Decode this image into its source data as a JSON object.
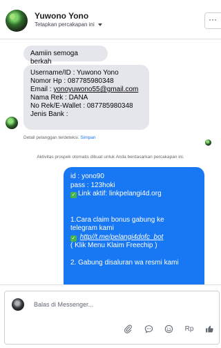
{
  "header": {
    "name": "Yuwono Yono",
    "subtitle": "Tetapkan percakapan ini",
    "more_label": "···"
  },
  "messages": {
    "m1": "Aamiin semoga berkah",
    "m2_lines": [
      "Username/ID : Yuwono Yono",
      "Nomor Hp : 087785980348",
      "Email : ",
      "Nama Rek : DANA",
      "No Rek/E-Wallet : 087785980348",
      "Jenis Bank :"
    ],
    "email_link": "yonoyuwono55@gmail.com",
    "detect_text": "Detail pelanggan terdeteksi.",
    "detect_save": "Simpan",
    "notice": "Aktivitas prospek otomatis dibuat untuk Anda berdasarkan percakapan ini.",
    "blue": {
      "l1": "id : yono90",
      "l2": "pass : 123hoki",
      "l3": "Link aktif: linkpelangi4d.org",
      "l4": "1.Cara claim bonus gabung ke",
      "l5": "telegram kami",
      "link2": "http//t.me/pelangi4dofc_bot",
      "l6": "( Klik Menu Klaim Freechip )",
      "l7": "2. Gabung disaluran wa resmi kami"
    }
  },
  "composer": {
    "placeholder": "Balas di Messenger...",
    "rp_label": "Rp"
  },
  "icons": {
    "checkmark": "green-check-icon",
    "clip": "paperclip-icon",
    "chat": "chat-bubble-icon",
    "smile": "smiley-icon",
    "like": "thumbs-up-icon"
  }
}
